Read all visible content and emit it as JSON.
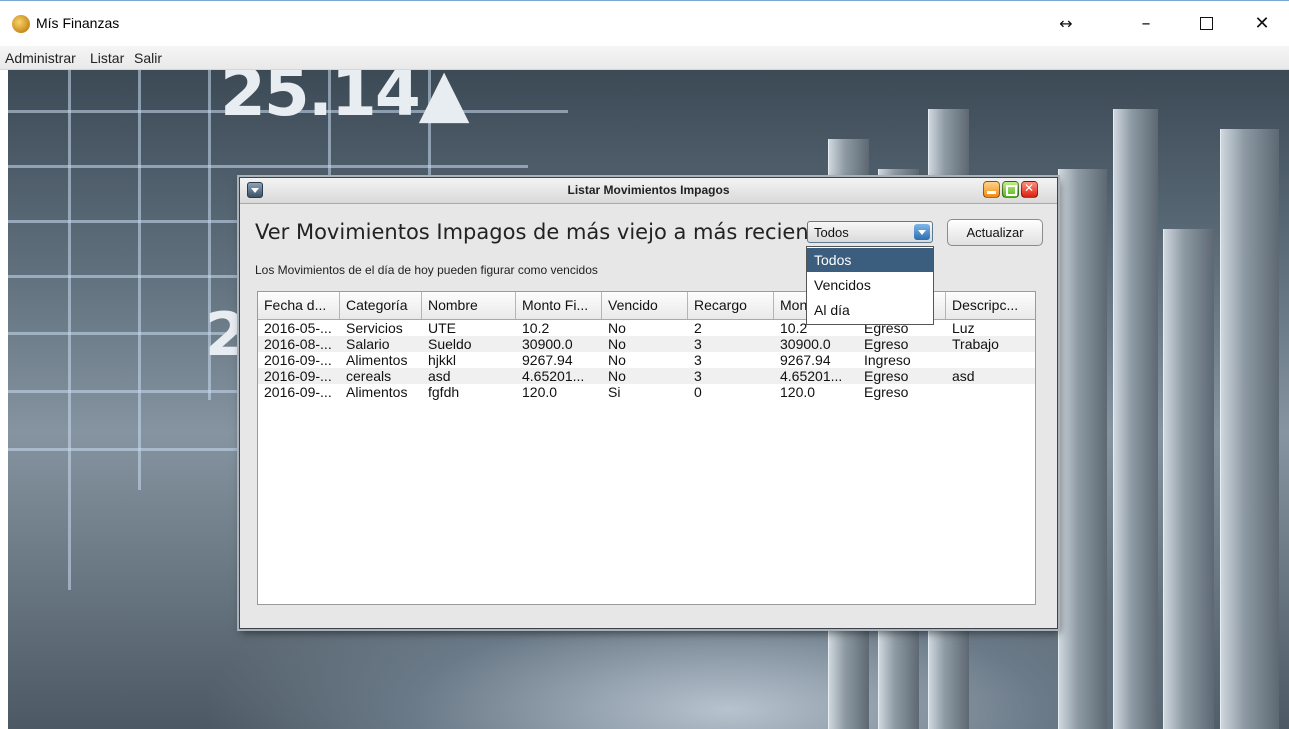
{
  "window": {
    "title": "Mís Finanzas",
    "controls": {
      "resize": "↔",
      "minimize": "–",
      "close": "✕"
    }
  },
  "menubar": {
    "items": [
      {
        "label": "Administrar"
      },
      {
        "label": "Listar"
      },
      {
        "label": "Salir"
      }
    ]
  },
  "background": {
    "big_number": "25.14▲",
    "big_number_2": "2"
  },
  "dialog": {
    "title": "Listar Movimientos Impagos",
    "heading": "Ver Movimientos Impagos de más viejo a más reciente",
    "subheading": "Los Movimientos de el día de hoy pueden figurar como vencidos",
    "filter": {
      "selected": "Todos",
      "options": [
        "Todos",
        "Vencidos",
        "Al día"
      ]
    },
    "refresh_label": "Actualizar",
    "table": {
      "columns": [
        "Fecha d...",
        "Categoría",
        "Nombre",
        "Monto Fi...",
        "Vencido",
        "Recargo",
        "Mon",
        "",
        "Descripc..."
      ],
      "rows": [
        [
          "2016-05-...",
          "Servicios",
          "UTE",
          "10.2",
          "No",
          "2",
          "10.2",
          "Egreso",
          "Luz"
        ],
        [
          "2016-08-...",
          "Salario",
          "Sueldo",
          "30900.0",
          "No",
          "3",
          "30900.0",
          "Egreso",
          "Trabajo"
        ],
        [
          "2016-09-...",
          "Alimentos",
          "hjkkl",
          "9267.94",
          "No",
          "3",
          "9267.94",
          "Ingreso",
          ""
        ],
        [
          "2016-09-...",
          "cereals",
          "asd",
          "4.65201...",
          "No",
          "3",
          "4.65201...",
          "Egreso",
          "asd"
        ],
        [
          "2016-09-...",
          "Alimentos",
          "fgfdh",
          "120.0",
          "Si",
          "0",
          "120.0",
          "Egreso",
          ""
        ]
      ]
    }
  },
  "colors": {
    "selection": "#3b5d7e",
    "dialog_bg": "#e7e7e7"
  }
}
